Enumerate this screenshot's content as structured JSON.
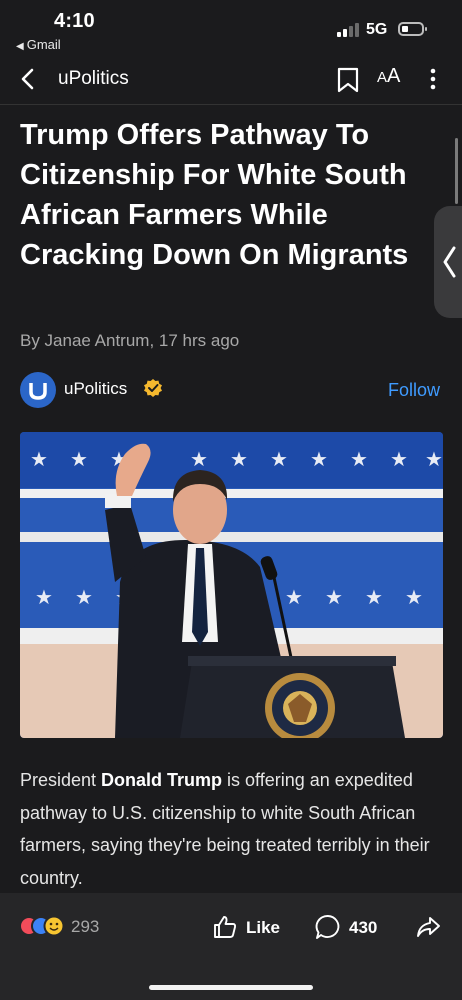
{
  "status_bar": {
    "time": "4:10",
    "back_app": "Gmail",
    "network": "5G"
  },
  "nav": {
    "title": "uPolitics",
    "text_size_label_small": "A",
    "text_size_label_large": "A"
  },
  "article": {
    "headline": "Trump Offers Pathway To Citizenship For White South African Farmers While Cracking Down On Migrants",
    "byline": "By Janae Antrum, 17 hrs ago",
    "publisher": {
      "name": "uPolitics",
      "logo_letter": "u",
      "follow_label": "Follow",
      "verified_color": "#f5b82e"
    },
    "image_seal_text": "PRESIDENT OF THE UNITED STATES",
    "body": {
      "prefix": "President ",
      "bold": "Donald Trump",
      "suffix": " is offering an expedited pathway to U.S. citizenship to white South African farmers, saying they're being treated terribly in their country."
    }
  },
  "actions": {
    "reaction_count": "293",
    "like_label": "Like",
    "comment_count": "430"
  },
  "colors": {
    "background": "#1b1b1d",
    "accent": "#3f9bff",
    "logo": "#2b66c8"
  }
}
